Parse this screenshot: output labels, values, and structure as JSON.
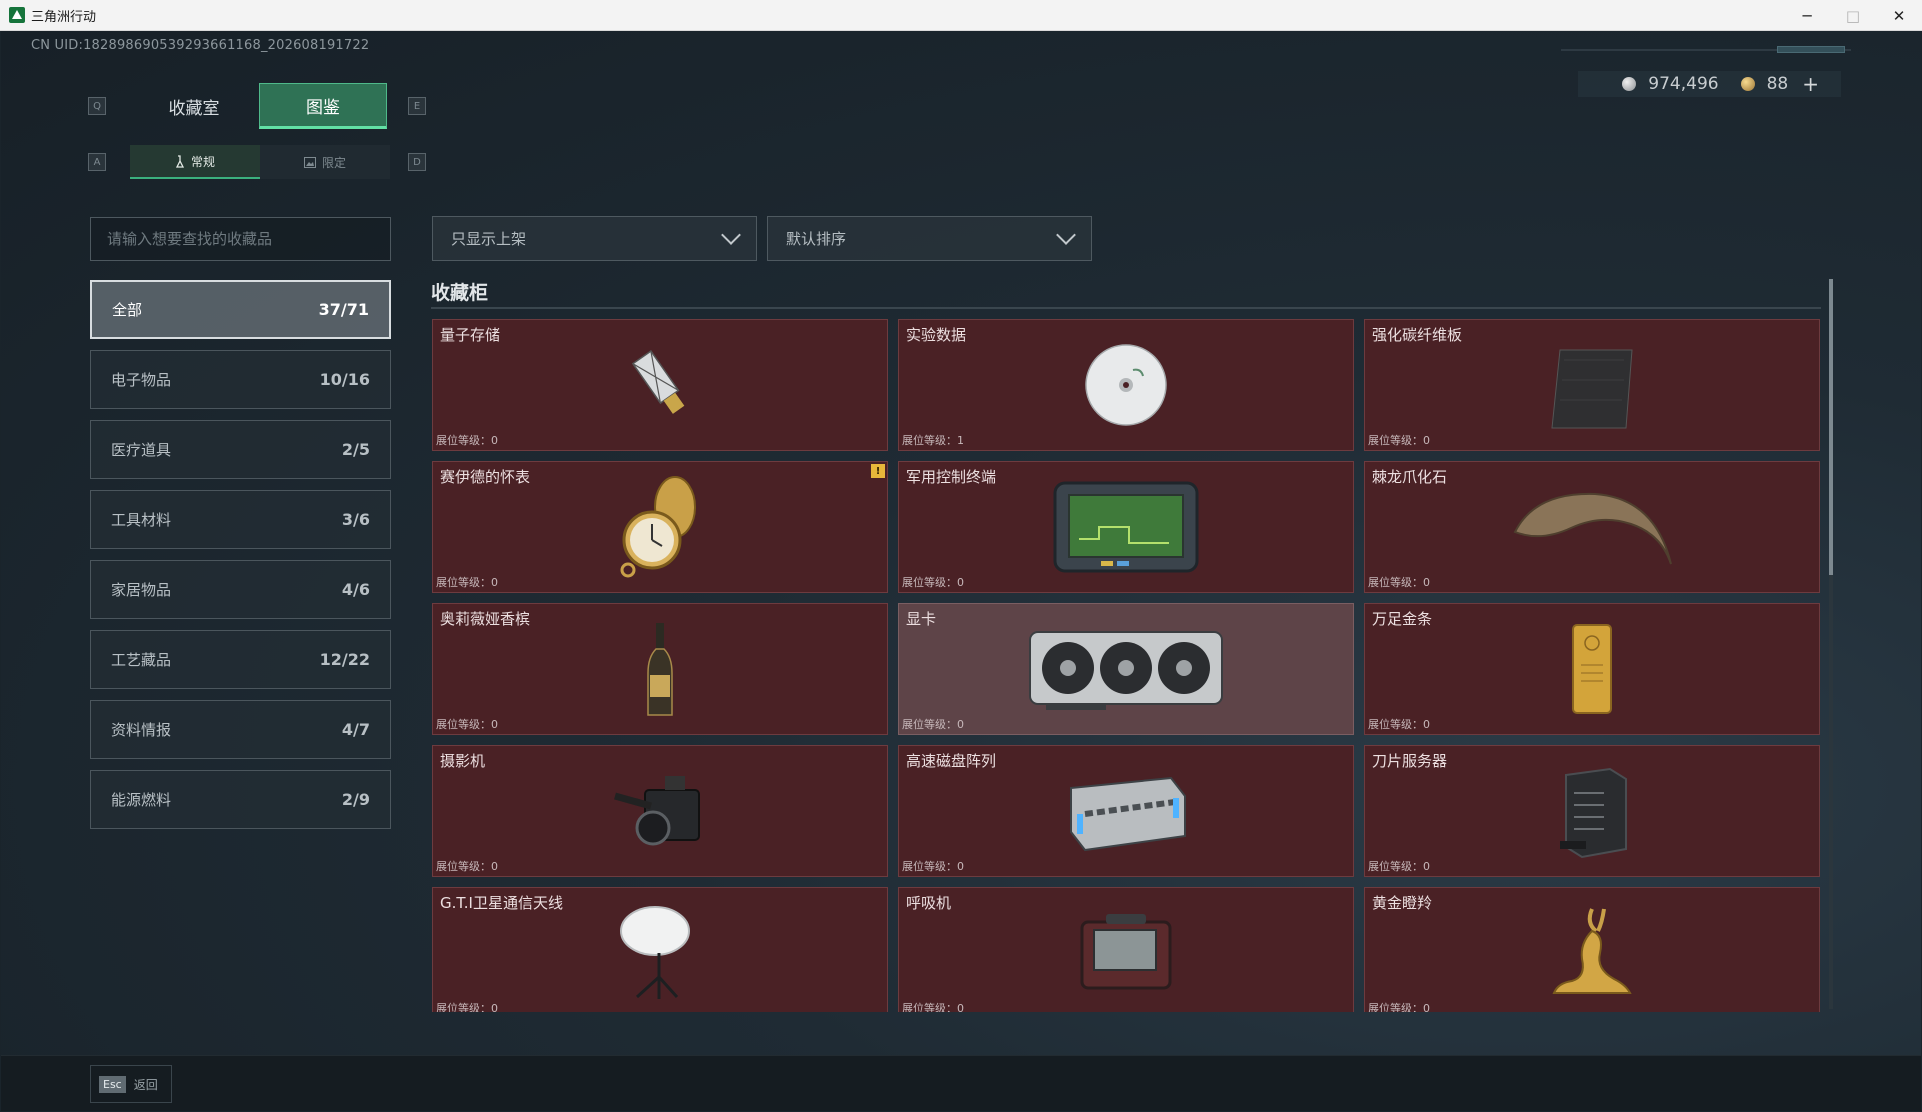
{
  "window": {
    "title": "三角洲行动",
    "minimize": "─",
    "maximize": "□",
    "close": "✕"
  },
  "header": {
    "uid": "CN UID:1828986905392936611​68_202608191722",
    "currency_silver": "974,496",
    "currency_gold": "88",
    "add_label": "+"
  },
  "tabs": {
    "key_left": "Q",
    "key_right": "E",
    "main": [
      "收藏室",
      "图鉴"
    ],
    "sub_key_left": "A",
    "sub_key_right": "D",
    "sub": [
      "常规",
      "限定"
    ]
  },
  "search": {
    "placeholder": "请输入想要查找的收藏品"
  },
  "categories": [
    {
      "label": "全部",
      "count": "37/71"
    },
    {
      "label": "电子物品",
      "count": "10/16"
    },
    {
      "label": "医疗道具",
      "count": "2/5"
    },
    {
      "label": "工具材料",
      "count": "3/6"
    },
    {
      "label": "家居物品",
      "count": "4/6"
    },
    {
      "label": "工艺藏品",
      "count": "12/22"
    },
    {
      "label": "资料情报",
      "count": "4/7"
    },
    {
      "label": "能源燃料",
      "count": "2/9"
    }
  ],
  "filters": {
    "shelf": "只显示上架",
    "sort": "默认排序"
  },
  "section": {
    "title": "收藏柜"
  },
  "items": [
    {
      "name": "量子存储",
      "level": "展位等级：0",
      "icon": "usb-drive-icon"
    },
    {
      "name": "实验数据",
      "level": "展位等级：1",
      "icon": "disc-icon"
    },
    {
      "name": "强化碳纤维板",
      "level": "展位等级：0",
      "icon": "carbon-plate-icon"
    },
    {
      "name": "赛伊德的怀表",
      "level": "展位等级：0",
      "icon": "pocket-watch-icon",
      "badge": "!"
    },
    {
      "name": "军用控制终端",
      "level": "展位等级：0",
      "icon": "control-terminal-icon"
    },
    {
      "name": "棘龙爪化石",
      "level": "展位等级：0",
      "icon": "claw-fossil-icon"
    },
    {
      "name": "奥莉薇娅香槟",
      "level": "展位等级：0",
      "icon": "champagne-icon"
    },
    {
      "name": "显卡",
      "level": "展位等级：0",
      "icon": "graphics-card-icon"
    },
    {
      "name": "万足金条",
      "level": "展位等级：0",
      "icon": "gold-bar-icon"
    },
    {
      "name": "摄影机",
      "level": "展位等级：0",
      "icon": "camera-icon"
    },
    {
      "name": "高速磁盘阵列",
      "level": "展位等级：0",
      "icon": "disk-array-icon"
    },
    {
      "name": "刀片服务器",
      "level": "展位等级：0",
      "icon": "blade-server-icon"
    },
    {
      "name": "G.T.I卫星通信天线",
      "level": "展位等级：0",
      "icon": "satellite-dish-icon"
    },
    {
      "name": "呼吸机",
      "level": "展位等级：0",
      "icon": "ventilator-icon"
    },
    {
      "name": "黄金瞪羚",
      "level": "展位等级：0",
      "icon": "gold-gazelle-icon"
    }
  ],
  "footer": {
    "esc_key": "Esc",
    "esc_label": "返回"
  }
}
